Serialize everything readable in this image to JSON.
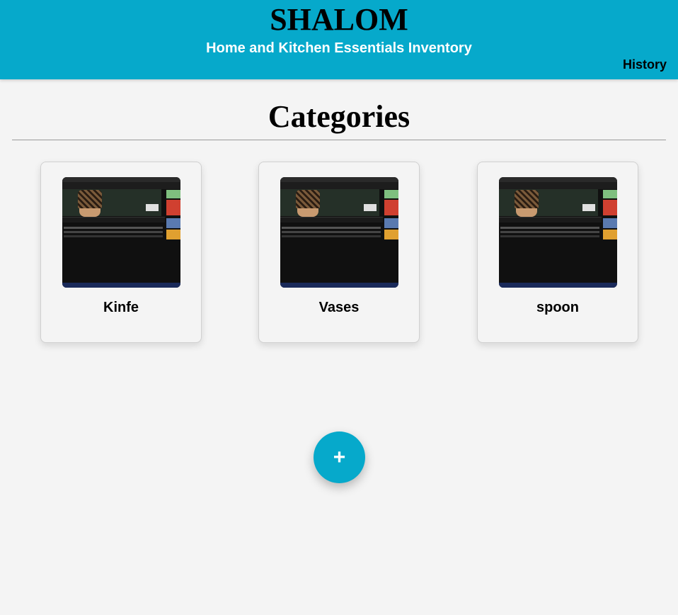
{
  "header": {
    "brand": "SHALOM",
    "subtitle": "Home and Kitchen Essentials Inventory",
    "history_label": "History",
    "bg_color": "#06a9cb"
  },
  "main": {
    "section_title": "Categories",
    "categories": [
      {
        "label": "Kinfe"
      },
      {
        "label": "Vases"
      },
      {
        "label": "spoon"
      }
    ],
    "add_button_label": "+"
  }
}
